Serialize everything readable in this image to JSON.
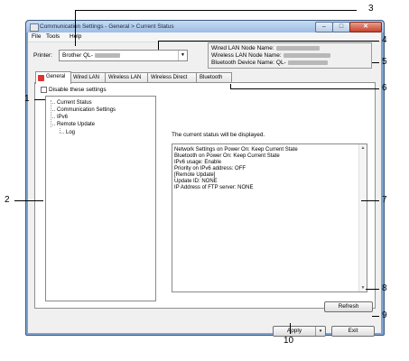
{
  "window": {
    "title": "Communication Settings - General > Current Status",
    "minimize": "–",
    "maximize": "□",
    "close": "✕"
  },
  "menu": [
    "File",
    "Tools",
    "Help"
  ],
  "printer": {
    "label": "Printer:",
    "value": "Brother QL-"
  },
  "node_names": [
    "Wired LAN Node Name:",
    "Wireless LAN Node Name:",
    "Bluetooth Device Name: QL-"
  ],
  "tabs": [
    "General",
    "Wired LAN",
    "Wireless LAN",
    "Wireless Direct",
    "Bluetooth"
  ],
  "disable_settings": "Disable these settings",
  "tree": [
    "Current Status",
    "Communication Settings",
    "IPv6",
    "Remote Update",
    "Log"
  ],
  "status_message": "The current status will be displayed.",
  "status_lines": [
    "Network Settings on Power On: Keep Current State",
    "Bluetooth on Power On: Keep Current State",
    "IPv6 usage: Enable",
    "Priority on IPv6 address: OFF",
    "[Remote Update]",
    "Update ID: NONE",
    "IP Address of FTP server: NONE"
  ],
  "buttons": {
    "refresh": "Refresh",
    "apply": "Apply",
    "apply_dropdown": "▾",
    "exit": "Exit"
  },
  "callouts": [
    "1",
    "2",
    "3",
    "4",
    "5",
    "6",
    "7",
    "8",
    "9",
    "10"
  ]
}
